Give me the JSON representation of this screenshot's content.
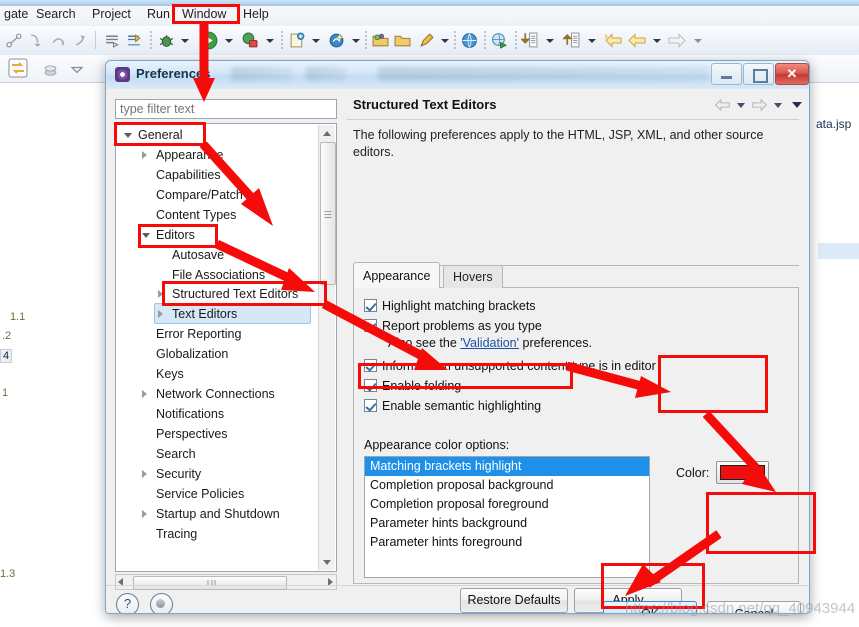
{
  "app": {
    "menus": [
      "gate",
      "Search",
      "Project",
      "Run",
      "Window",
      "Help"
    ],
    "editor_tab": "ata.jsp",
    "background_code": [
      "1.1",
      ".2",
      "4",
      "1",
      "1.3"
    ]
  },
  "dialog": {
    "title": "Preferences",
    "window_buttons": {
      "minimize": "–",
      "maximize": "□",
      "close": "✕"
    },
    "filter": {
      "placeholder": "type filter text",
      "value": ""
    },
    "tree": [
      {
        "label": "General",
        "depth": 0,
        "twisty": "expanded",
        "selected": false
      },
      {
        "label": "Appearance",
        "depth": 1,
        "twisty": "collapsed",
        "selected": false
      },
      {
        "label": "Capabilities",
        "depth": 1,
        "twisty": "none",
        "selected": false
      },
      {
        "label": "Compare/Patch",
        "depth": 1,
        "twisty": "none",
        "selected": false
      },
      {
        "label": "Content Types",
        "depth": 1,
        "twisty": "none",
        "selected": false
      },
      {
        "label": "Editors",
        "depth": 1,
        "twisty": "expanded",
        "selected": false
      },
      {
        "label": "Autosave",
        "depth": 2,
        "twisty": "none",
        "selected": false
      },
      {
        "label": "File Associations",
        "depth": 2,
        "twisty": "none",
        "selected": false
      },
      {
        "label": "Structured Text Editors",
        "depth": 2,
        "twisty": "collapsed",
        "selected": true
      },
      {
        "label": "Text Editors",
        "depth": 2,
        "twisty": "collapsed",
        "selected": false
      },
      {
        "label": "Error Reporting",
        "depth": 1,
        "twisty": "none",
        "selected": false
      },
      {
        "label": "Globalization",
        "depth": 1,
        "twisty": "none",
        "selected": false
      },
      {
        "label": "Keys",
        "depth": 1,
        "twisty": "none",
        "selected": false
      },
      {
        "label": "Network Connections",
        "depth": 1,
        "twisty": "collapsed",
        "selected": false
      },
      {
        "label": "Notifications",
        "depth": 1,
        "twisty": "none",
        "selected": false
      },
      {
        "label": "Perspectives",
        "depth": 1,
        "twisty": "none",
        "selected": false
      },
      {
        "label": "Search",
        "depth": 1,
        "twisty": "none",
        "selected": false
      },
      {
        "label": "Security",
        "depth": 1,
        "twisty": "collapsed",
        "selected": false
      },
      {
        "label": "Service Policies",
        "depth": 1,
        "twisty": "none",
        "selected": false
      },
      {
        "label": "Startup and Shutdown",
        "depth": 1,
        "twisty": "collapsed",
        "selected": false
      },
      {
        "label": "Tracing",
        "depth": 1,
        "twisty": "none",
        "selected": false
      }
    ],
    "pane": {
      "title": "Structured Text Editors",
      "description": "The following preferences apply to the HTML, JSP, XML, and other source editors.",
      "tabs": [
        {
          "label": "Appearance",
          "active": true
        },
        {
          "label": "Hovers",
          "active": false
        }
      ],
      "checkboxes": [
        {
          "label": "Highlight matching brackets",
          "checked": true
        },
        {
          "label": "Report problems as you type",
          "checked": true
        },
        {
          "label": "Inform when unsupported content type is in editor",
          "checked": true
        },
        {
          "label": "Enable folding",
          "checked": true
        },
        {
          "label": "Enable semantic highlighting",
          "checked": true
        }
      ],
      "validation_note_prefix": "Also see the ",
      "validation_link": "'Validation'",
      "validation_note_suffix": " preferences.",
      "color_options_label": "Appearance color options:",
      "color_options": [
        {
          "label": "Matching brackets highlight",
          "selected": true
        },
        {
          "label": "Completion proposal background",
          "selected": false
        },
        {
          "label": "Completion proposal foreground",
          "selected": false
        },
        {
          "label": "Parameter hints background",
          "selected": false
        },
        {
          "label": "Parameter hints foreground",
          "selected": false
        }
      ],
      "color_label": "Color:",
      "color_value": "#ee0f0f"
    },
    "buttons": {
      "restore_defaults": "Restore Defaults",
      "apply": "Apply",
      "ok": "OK",
      "cancel": "Cancel",
      "help": "?"
    }
  },
  "watermark": "https://blog.csdn.net/qq_40943944"
}
